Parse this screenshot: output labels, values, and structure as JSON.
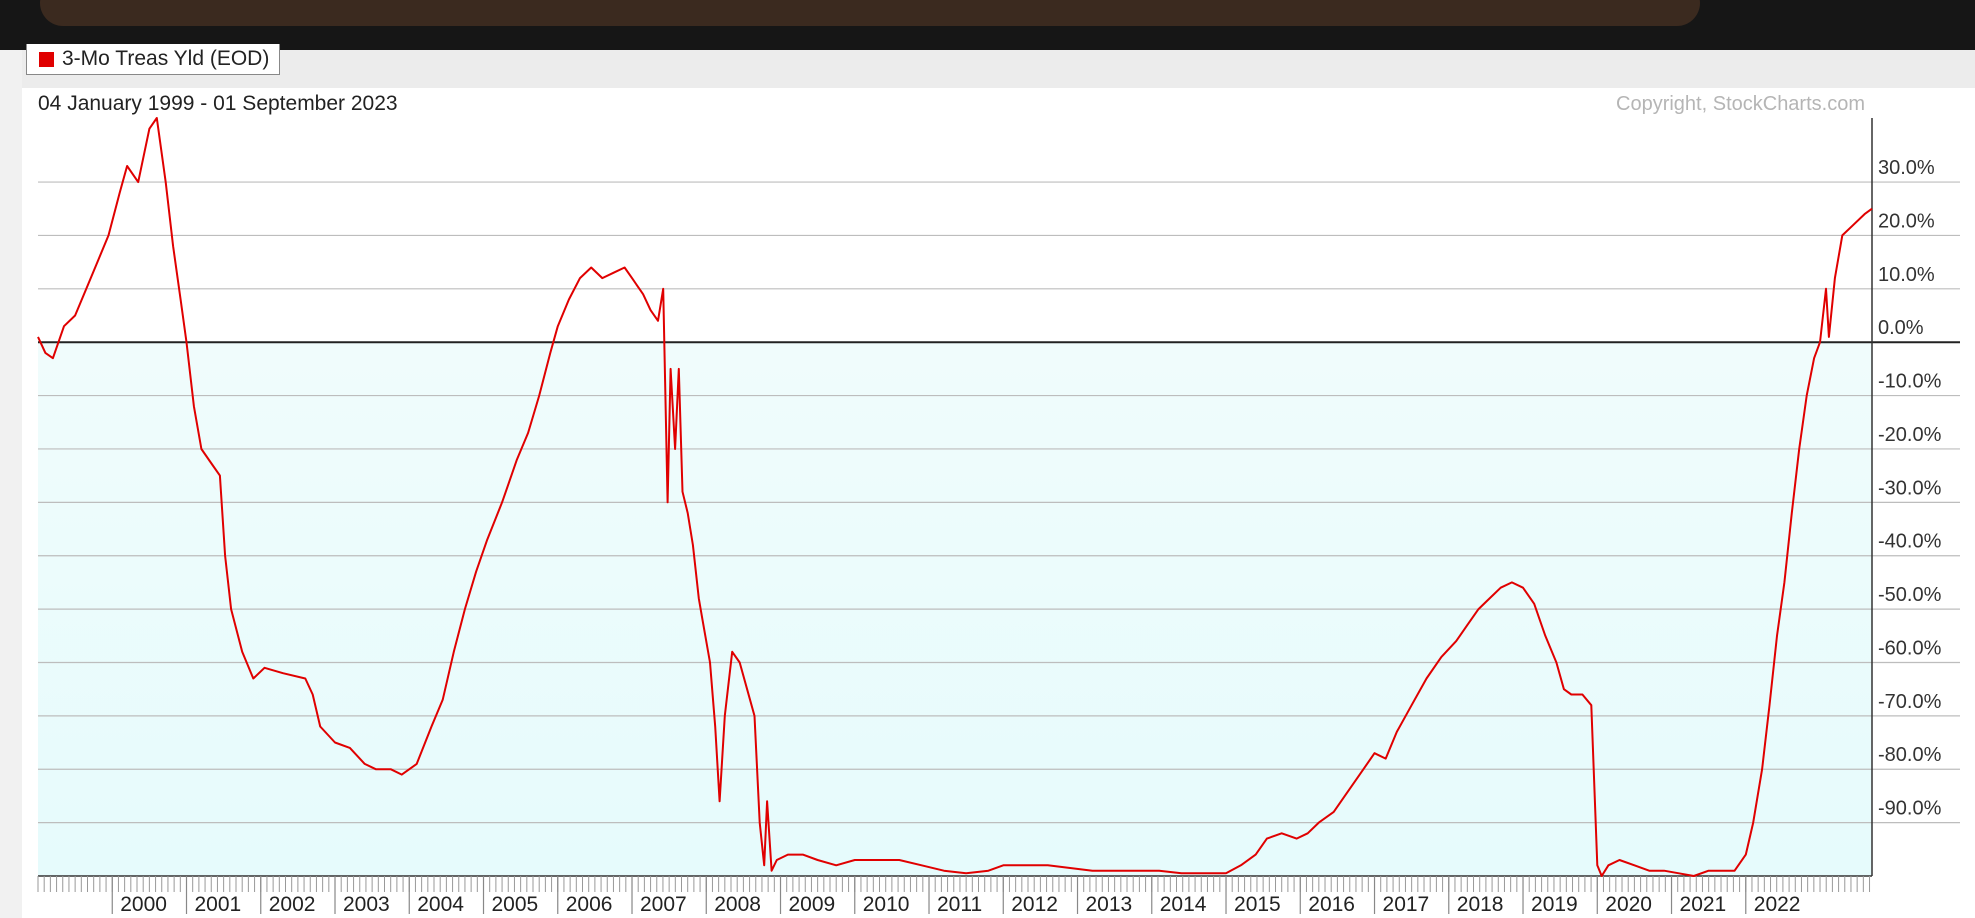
{
  "legend": {
    "label": "3-Mo Treas Yld (EOD)",
    "color": "#e00000"
  },
  "chart_data": {
    "type": "line",
    "subtitle": "04 January 1999 - 01 September 2023",
    "copyright": "Copyright, StockCharts.com",
    "x_ticks": [
      "2000",
      "2001",
      "2002",
      "2003",
      "2004",
      "2005",
      "2006",
      "2007",
      "2008",
      "2009",
      "2010",
      "2011",
      "2012",
      "2013",
      "2014",
      "2015",
      "2016",
      "2017",
      "2018",
      "2019",
      "2020",
      "2021",
      "2022"
    ],
    "y_ticks": [
      {
        "v": 30,
        "label": "30.0%"
      },
      {
        "v": 20,
        "label": "20.0%"
      },
      {
        "v": 10,
        "label": "10.0%"
      },
      {
        "v": 0,
        "label": "0.0%"
      },
      {
        "v": -10,
        "label": "-10.0%"
      },
      {
        "v": -20,
        "label": "-20.0%"
      },
      {
        "v": -30,
        "label": "-30.0%"
      },
      {
        "v": -40,
        "label": "-40.0%"
      },
      {
        "v": -50,
        "label": "-50.0%"
      },
      {
        "v": -60,
        "label": "-60.0%"
      },
      {
        "v": -70,
        "label": "-70.0%"
      },
      {
        "v": -80,
        "label": "-80.0%"
      },
      {
        "v": -90,
        "label": "-90.0%"
      }
    ],
    "ylim": [
      -100,
      42
    ],
    "xlim": [
      1999.0,
      2023.7
    ],
    "series": [
      {
        "color": "#e00000",
        "points": [
          [
            1999.0,
            1
          ],
          [
            1999.1,
            -2
          ],
          [
            1999.2,
            -3
          ],
          [
            1999.35,
            3
          ],
          [
            1999.5,
            5
          ],
          [
            1999.65,
            10
          ],
          [
            1999.8,
            15
          ],
          [
            1999.95,
            20
          ],
          [
            2000.1,
            28
          ],
          [
            2000.2,
            33
          ],
          [
            2000.35,
            30
          ],
          [
            2000.5,
            40
          ],
          [
            2000.6,
            42
          ],
          [
            2000.72,
            30
          ],
          [
            2000.82,
            18
          ],
          [
            2000.92,
            8
          ],
          [
            2001.0,
            0
          ],
          [
            2001.1,
            -12
          ],
          [
            2001.2,
            -20
          ],
          [
            2001.35,
            -23
          ],
          [
            2001.45,
            -25
          ],
          [
            2001.52,
            -40
          ],
          [
            2001.6,
            -50
          ],
          [
            2001.75,
            -58
          ],
          [
            2001.9,
            -63
          ],
          [
            2002.05,
            -61
          ],
          [
            2002.3,
            -62
          ],
          [
            2002.6,
            -63
          ],
          [
            2002.7,
            -66
          ],
          [
            2002.8,
            -72
          ],
          [
            2003.0,
            -75
          ],
          [
            2003.2,
            -76
          ],
          [
            2003.4,
            -79
          ],
          [
            2003.55,
            -80
          ],
          [
            2003.75,
            -80
          ],
          [
            2003.9,
            -81
          ],
          [
            2004.1,
            -79
          ],
          [
            2004.3,
            -72
          ],
          [
            2004.45,
            -67
          ],
          [
            2004.6,
            -58
          ],
          [
            2004.75,
            -50
          ],
          [
            2004.9,
            -43
          ],
          [
            2005.05,
            -37
          ],
          [
            2005.25,
            -30
          ],
          [
            2005.45,
            -22
          ],
          [
            2005.6,
            -17
          ],
          [
            2005.75,
            -10
          ],
          [
            2005.9,
            -2
          ],
          [
            2006.0,
            3
          ],
          [
            2006.15,
            8
          ],
          [
            2006.3,
            12
          ],
          [
            2006.45,
            14
          ],
          [
            2006.6,
            12
          ],
          [
            2006.75,
            13
          ],
          [
            2006.9,
            14
          ],
          [
            2007.0,
            12
          ],
          [
            2007.15,
            9
          ],
          [
            2007.25,
            6
          ],
          [
            2007.35,
            4
          ],
          [
            2007.42,
            10
          ],
          [
            2007.48,
            -30
          ],
          [
            2007.52,
            -5
          ],
          [
            2007.58,
            -20
          ],
          [
            2007.63,
            -5
          ],
          [
            2007.68,
            -28
          ],
          [
            2007.75,
            -32
          ],
          [
            2007.82,
            -38
          ],
          [
            2007.9,
            -48
          ],
          [
            2007.95,
            -52
          ],
          [
            2008.05,
            -60
          ],
          [
            2008.12,
            -72
          ],
          [
            2008.18,
            -86
          ],
          [
            2008.25,
            -70
          ],
          [
            2008.35,
            -58
          ],
          [
            2008.45,
            -60
          ],
          [
            2008.55,
            -65
          ],
          [
            2008.65,
            -70
          ],
          [
            2008.72,
            -90
          ],
          [
            2008.78,
            -98
          ],
          [
            2008.82,
            -86
          ],
          [
            2008.88,
            -99
          ],
          [
            2008.95,
            -97
          ],
          [
            2009.1,
            -96
          ],
          [
            2009.3,
            -96
          ],
          [
            2009.5,
            -97
          ],
          [
            2009.75,
            -98
          ],
          [
            2010.0,
            -97
          ],
          [
            2010.3,
            -97
          ],
          [
            2010.6,
            -97
          ],
          [
            2010.9,
            -98
          ],
          [
            2011.2,
            -99
          ],
          [
            2011.5,
            -99.5
          ],
          [
            2011.8,
            -99
          ],
          [
            2012.0,
            -98
          ],
          [
            2012.3,
            -98
          ],
          [
            2012.6,
            -98
          ],
          [
            2012.9,
            -98.5
          ],
          [
            2013.2,
            -99
          ],
          [
            2013.5,
            -99
          ],
          [
            2013.8,
            -99
          ],
          [
            2014.1,
            -99
          ],
          [
            2014.4,
            -99.5
          ],
          [
            2014.7,
            -99.5
          ],
          [
            2015.0,
            -99.5
          ],
          [
            2015.2,
            -98
          ],
          [
            2015.4,
            -96
          ],
          [
            2015.55,
            -93
          ],
          [
            2015.75,
            -92
          ],
          [
            2015.95,
            -93
          ],
          [
            2016.1,
            -92
          ],
          [
            2016.25,
            -90
          ],
          [
            2016.45,
            -88
          ],
          [
            2016.6,
            -85
          ],
          [
            2016.8,
            -81
          ],
          [
            2017.0,
            -77
          ],
          [
            2017.15,
            -78
          ],
          [
            2017.3,
            -73
          ],
          [
            2017.5,
            -68
          ],
          [
            2017.7,
            -63
          ],
          [
            2017.9,
            -59
          ],
          [
            2018.1,
            -56
          ],
          [
            2018.25,
            -53
          ],
          [
            2018.4,
            -50
          ],
          [
            2018.55,
            -48
          ],
          [
            2018.7,
            -46
          ],
          [
            2018.85,
            -45
          ],
          [
            2019.0,
            -46
          ],
          [
            2019.15,
            -49
          ],
          [
            2019.3,
            -55
          ],
          [
            2019.45,
            -60
          ],
          [
            2019.55,
            -65
          ],
          [
            2019.65,
            -66
          ],
          [
            2019.8,
            -66
          ],
          [
            2019.92,
            -68
          ],
          [
            2020.0,
            -98
          ],
          [
            2020.06,
            -100
          ],
          [
            2020.15,
            -98
          ],
          [
            2020.3,
            -97
          ],
          [
            2020.5,
            -98
          ],
          [
            2020.7,
            -99
          ],
          [
            2020.9,
            -99
          ],
          [
            2021.1,
            -99.5
          ],
          [
            2021.3,
            -100
          ],
          [
            2021.5,
            -99
          ],
          [
            2021.7,
            -99
          ],
          [
            2021.85,
            -99
          ],
          [
            2022.0,
            -96
          ],
          [
            2022.1,
            -90
          ],
          [
            2022.22,
            -80
          ],
          [
            2022.32,
            -68
          ],
          [
            2022.42,
            -55
          ],
          [
            2022.52,
            -45
          ],
          [
            2022.62,
            -32
          ],
          [
            2022.72,
            -20
          ],
          [
            2022.82,
            -10
          ],
          [
            2022.92,
            -3
          ],
          [
            2023.0,
            0
          ],
          [
            2023.08,
            10
          ],
          [
            2023.12,
            1
          ],
          [
            2023.2,
            12
          ],
          [
            2023.3,
            20
          ],
          [
            2023.45,
            22
          ],
          [
            2023.6,
            24
          ],
          [
            2023.7,
            25
          ]
        ]
      }
    ]
  }
}
